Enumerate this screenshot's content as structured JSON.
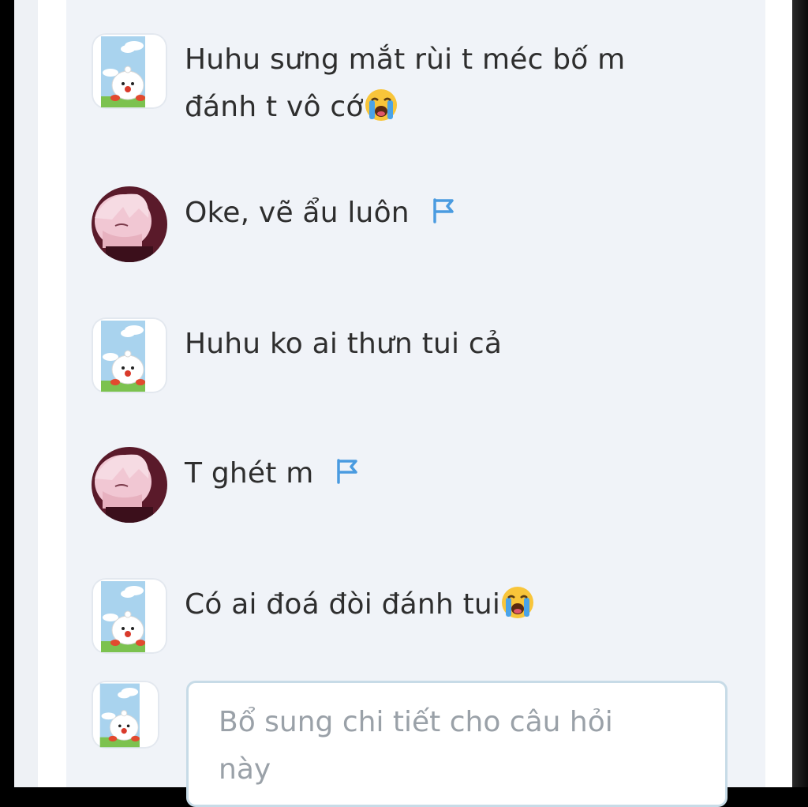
{
  "comments": [
    {
      "author_avatar": "chick-cartoon-avatar",
      "text": "Huhu sưng mắt rùi t méc bố m đánh t vô cớ",
      "emoji": "loudly-crying-face",
      "flag": false
    },
    {
      "author_avatar": "anime-boy-avatar",
      "text": "Oke, vẽ ẩu luôn",
      "emoji": null,
      "flag": true
    },
    {
      "author_avatar": "chick-cartoon-avatar",
      "text": "Huhu ko ai thưn tui cả",
      "emoji": null,
      "flag": false
    },
    {
      "author_avatar": "anime-boy-avatar",
      "text": "T ghét m",
      "emoji": null,
      "flag": true
    },
    {
      "author_avatar": "chick-cartoon-avatar",
      "text": "Có ai đoá đòi đánh tui",
      "emoji": "loudly-crying-face",
      "flag": false
    }
  ],
  "composer": {
    "avatar": "chick-cartoon-avatar",
    "placeholder": "Bổ sung chi tiết cho câu hỏi này"
  },
  "colors": {
    "card_bg": "#f0f3f8",
    "text": "#2e2e2e",
    "flag_blue": "#4a9be0",
    "input_border": "#c7dbe7",
    "placeholder": "#9aa1a8"
  }
}
